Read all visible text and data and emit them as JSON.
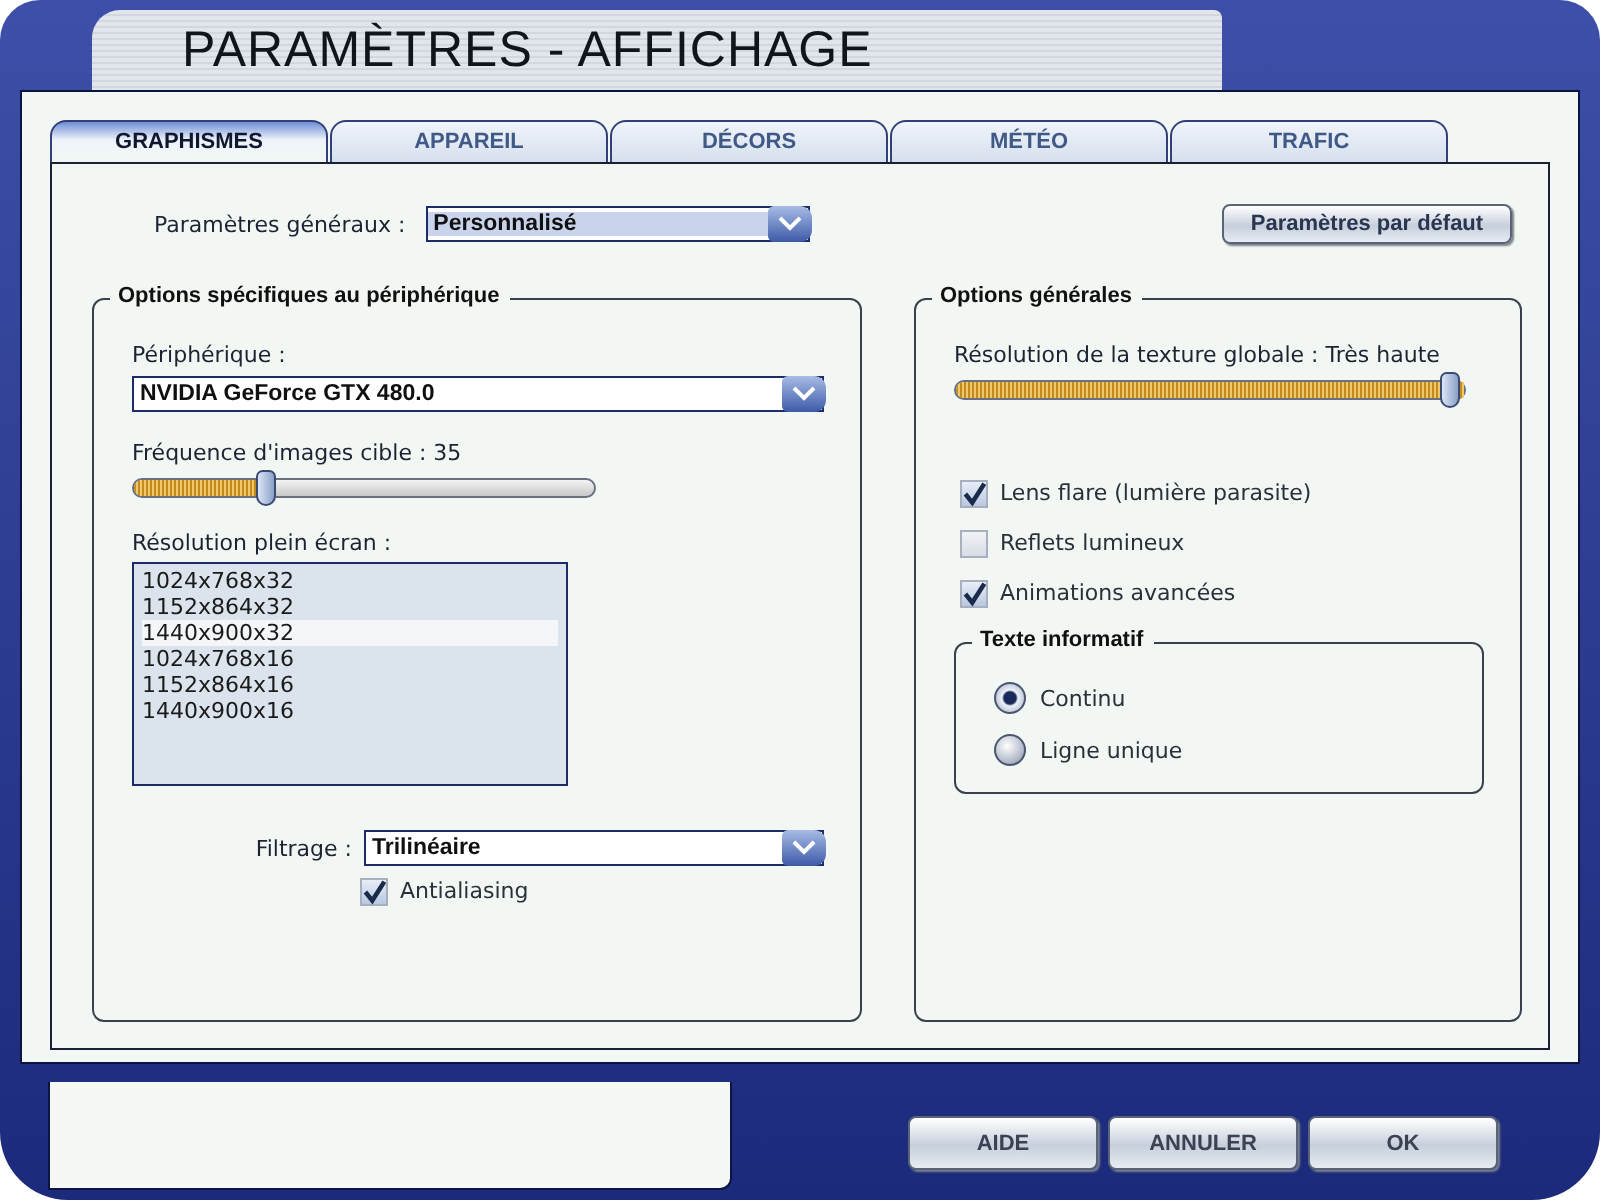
{
  "window": {
    "title": "PARAMÈTRES - AFFICHAGE"
  },
  "tabs": [
    {
      "label": "GRAPHISMES",
      "selected": true
    },
    {
      "label": "APPAREIL",
      "selected": false
    },
    {
      "label": "DÉCORS",
      "selected": false
    },
    {
      "label": "MÉTÉO",
      "selected": false
    },
    {
      "label": "TRAFIC",
      "selected": false
    }
  ],
  "general_settings": {
    "label": "Paramètres généraux :",
    "value": "Personnalisé"
  },
  "default_button": "Paramètres par défaut",
  "device_group": {
    "title": "Options spécifiques au périphérique",
    "device": {
      "label": "Périphérique :",
      "value": "NVIDIA GeForce GTX 480.0"
    },
    "frame_rate": {
      "label": "Fréquence d'images cible : 35",
      "level": 0.28
    },
    "resolution": {
      "label": "Résolution plein écran :",
      "items": [
        {
          "text": "1024x768x32",
          "selected": false
        },
        {
          "text": "1152x864x32",
          "selected": false
        },
        {
          "text": "1440x900x32",
          "selected": true
        },
        {
          "text": "1024x768x16",
          "selected": false
        },
        {
          "text": "1152x864x16",
          "selected": false
        },
        {
          "text": "1440x900x16",
          "selected": false
        }
      ]
    },
    "filtering": {
      "label": "Filtrage :",
      "value": "Trilinéaire"
    },
    "antialiasing": {
      "label": "Antialiasing",
      "checked": true
    }
  },
  "general_group": {
    "title": "Options générales",
    "texture": {
      "label": "Résolution de la texture globale : Très haute",
      "level": 1
    },
    "options": [
      {
        "label": "Lens flare (lumière parasite)",
        "checked": true
      },
      {
        "label": "Reflets lumineux",
        "checked": false
      },
      {
        "label": "Animations avancées",
        "checked": true
      }
    ],
    "info_text": {
      "title": "Texte informatif",
      "options": [
        {
          "label": "Continu",
          "selected": true
        },
        {
          "label": "Ligne unique",
          "selected": false
        }
      ]
    }
  },
  "buttons": [
    "AIDE",
    "ANNULER",
    "OK"
  ]
}
